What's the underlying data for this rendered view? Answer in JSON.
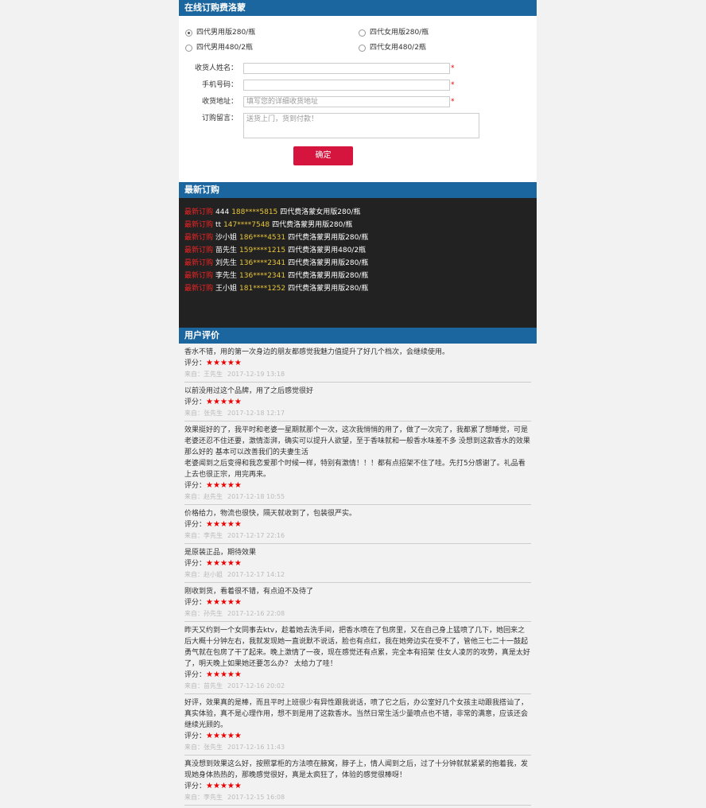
{
  "order": {
    "title": "在线订购费洛蒙",
    "options": [
      {
        "label": "四代男用版280/瓶",
        "checked": true
      },
      {
        "label": "四代女用版280/瓶",
        "checked": false
      },
      {
        "label": "四代男用480/2瓶",
        "checked": false
      },
      {
        "label": "四代女用480/2瓶",
        "checked": false
      }
    ],
    "name_label": "收货人姓名：",
    "phone_label": "手机号码：",
    "address_label": "收货地址：",
    "address_placeholder": "填写您的详细收货地址",
    "message_label": "订购留言：",
    "message_placeholder": "送货上门，货到付款！",
    "required_mark": "*",
    "submit_label": "确定"
  },
  "latest": {
    "title": "最新订购",
    "tag": "最新订购",
    "items": [
      {
        "name": "444",
        "phone": "188****5815",
        "product": "四代费洛蒙女用版280/瓶"
      },
      {
        "name": "tt",
        "phone": "147****7548",
        "product": "四代费洛蒙男用版280/瓶"
      },
      {
        "name": "沙小姐",
        "phone": "186****4531",
        "product": "四代费洛蒙男用版280/瓶"
      },
      {
        "name": "苗先生",
        "phone": "159****1215",
        "product": "四代费洛蒙男用480/2瓶"
      },
      {
        "name": "刘先生",
        "phone": "136****2341",
        "product": "四代费洛蒙男用版280/瓶"
      },
      {
        "name": "李先生",
        "phone": "136****2341",
        "product": "四代费洛蒙男用版280/瓶"
      },
      {
        "name": "王小姐",
        "phone": "181****1252",
        "product": "四代费洛蒙男用版280/瓶"
      }
    ]
  },
  "reviews": {
    "title": "用户评价",
    "score_label": "评分：",
    "stars": "★★★★★",
    "from_label": "来自：",
    "items": [
      {
        "text": "香水不错，用的第一次身边的朋友都感觉我魅力值提升了好几个档次，会继续使用。",
        "author": "王先生",
        "date": "2017-12-19 13:18"
      },
      {
        "text": "以前没用过这个品牌，用了之后感觉很好",
        "author": "张先生",
        "date": "2017-12-18 12:17"
      },
      {
        "text": "效果挺好的了，我平时和老婆一星期就那个一次，这次我悄悄的用了，做了一次完了，我都累了想睡觉，可是老婆还忍不住还要，激情澎湃，确实可以提升人欲望，至于香味就和一般香水味差不多 没想到这款香水的效果那么好的 基本可以改善我们的夫妻生活\n老婆闻到之后变得和我恋爱那个时候一样，特别有激情！！！都有点招架不住了哇。先打5分感谢了。礼品看上去也很正宗，用完再来。",
        "author": "赵先生",
        "date": "2017-12-18 10:55"
      },
      {
        "text": "价格给力，物流也很快，隔天就收到了，包装很严实。",
        "author": "李先生",
        "date": "2017-12-17 22:16"
      },
      {
        "text": "是原装正品，期待效果",
        "author": "赵小姐",
        "date": "2017-12-17 14:12"
      },
      {
        "text": "刚收到货，看着很不错，有点迫不及待了",
        "author": "孙先生",
        "date": "2017-12-16 22:08"
      },
      {
        "text": "昨天又约到一个女同事去ktv，趁着她去洗手间，把香水喷在了包房里，又在自己身上猛喷了几下，她回来之后大概十分钟左右，我就发现她一直说默不说话，脸也有点红，我在她旁边实在受不了，管他三七二十一鼓起勇气就在包房了干了起来。晚上激情了一夜，现在感觉还有点累，完全本有招架 住女人凌厉的攻势，真是太好了，明天晚上如果她还要怎么办？ 太给力了哇！",
        "author": "苗先生",
        "date": "2017-12-16 20:02"
      },
      {
        "text": "好评，效果真的是棒，而且平时上班很少有异性跟我说话，喷了它之后，办公室好几个女孩主动跟我搭讪了，真实体验，真不是心理作用，想不到是用了这款香水。当然日常生活少量喷点也不错，非常的满意，应该还会继续光顾的。",
        "author": "张先生",
        "date": "2017-12-16 11:43"
      },
      {
        "text": "真没想到效果这么好，按照掌柜的方法喷在腋窝，脖子上，情人闻到之后，过了十分钟就就紧紧的抱着我，发现她身体热热的，那晚感觉很好，真是太疯狂了，体验的感觉很棒呀！",
        "author": "李先生",
        "date": "2017-12-15 16:08"
      }
    ]
  }
}
